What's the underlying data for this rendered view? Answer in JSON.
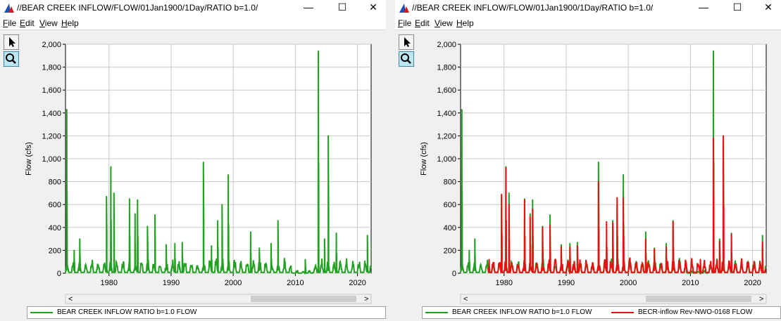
{
  "windows": [
    {
      "title": "//BEAR CREEK INFLOW/FLOW/01Jan1900/1Day/RATIO b=1.0/",
      "menu": [
        {
          "ul": "F",
          "rest": "ile"
        },
        {
          "ul": "E",
          "rest": "dit"
        },
        {
          "ul": "V",
          "rest": "iew"
        },
        {
          "ul": "H",
          "rest": "elp"
        }
      ],
      "legend": [
        {
          "label": "BEAR CREEK INFLOW RATIO b=1.0 FLOW",
          "color": "#22a022"
        }
      ]
    },
    {
      "title": "//BEAR CREEK INFLOW/FLOW/01Jan1900/1Day/RATIO b=1.0/",
      "menu": [
        {
          "ul": "F",
          "rest": "ile"
        },
        {
          "ul": "E",
          "rest": "dit"
        },
        {
          "ul": "V",
          "rest": "iew"
        },
        {
          "ul": "H",
          "rest": "elp"
        }
      ],
      "legend": [
        {
          "label": "BEAR CREEK INFLOW RATIO b=1.0 FLOW",
          "color": "#22a022"
        },
        {
          "label": "BECR-inflow Rev-NWO-0168 FLOW",
          "color": "#e81010"
        }
      ]
    }
  ],
  "window_controls": {
    "minimize": "—",
    "maximize": "☐",
    "close": "✕"
  },
  "icons": {
    "pointer": "pointer-arrow-icon",
    "zoom": "zoom-magnifier-icon",
    "app": "hec-dssvue-icon"
  },
  "chart_data": [
    {
      "type": "line",
      "ylabel": "Flow (cfs)",
      "xlabel": "",
      "title": "",
      "xlim": [
        1973.0,
        2022.2
      ],
      "ylim": [
        0,
        2000
      ],
      "yticks": [
        0,
        200,
        400,
        600,
        800,
        1000,
        1200,
        1400,
        1600,
        1800,
        2000
      ],
      "ytick_labels": [
        "0",
        "200",
        "400",
        "600",
        "800",
        "1,000",
        "1,200",
        "1,400",
        "1,600",
        "1,800",
        "2,000"
      ],
      "xticks": [
        1980,
        1990,
        2000,
        2010,
        2020
      ],
      "grid": true,
      "series": [
        {
          "name": "BEAR CREEK INFLOW RATIO b=1.0 FLOW",
          "color": "#22a022",
          "x": [
            1973.2,
            1974.4,
            1975.3,
            1979.6,
            1980.3,
            1980.8,
            1983.3,
            1984.2,
            1984.6,
            1986.2,
            1987.4,
            1989.2,
            1990.6,
            1991.8,
            1995.2,
            1996.5,
            1997.5,
            1998.2,
            1999.2,
            2002.8,
            2004.2,
            2006.1,
            2007.2,
            2011.6,
            2013.7,
            2014.7,
            2015.3,
            2016.6,
            2021.6
          ],
          "peaks": [
            1430,
            200,
            300,
            670,
            930,
            700,
            650,
            520,
            640,
            410,
            510,
            250,
            260,
            270,
            970,
            240,
            460,
            600,
            860,
            360,
            220,
            260,
            460,
            120,
            1940,
            300,
            1200,
            350,
            330
          ]
        }
      ]
    },
    {
      "type": "line",
      "ylabel": "Flow (cfs)",
      "xlabel": "",
      "title": "",
      "xlim": [
        1973.0,
        2022.2
      ],
      "ylim": [
        0,
        2000
      ],
      "yticks": [
        0,
        200,
        400,
        600,
        800,
        1000,
        1200,
        1400,
        1600,
        1800,
        2000
      ],
      "ytick_labels": [
        "0",
        "200",
        "400",
        "600",
        "800",
        "1,000",
        "1,200",
        "1,400",
        "1,600",
        "1,800",
        "2,000"
      ],
      "xticks": [
        1980,
        1990,
        2000,
        2010,
        2020
      ],
      "grid": true,
      "series": [
        {
          "name": "BEAR CREEK INFLOW RATIO b=1.0 FLOW",
          "color": "#22a022",
          "x": [
            1973.2,
            1974.4,
            1975.3,
            1979.6,
            1980.3,
            1980.8,
            1983.3,
            1984.2,
            1984.6,
            1986.2,
            1987.4,
            1989.2,
            1990.6,
            1991.8,
            1995.2,
            1996.5,
            1997.5,
            1998.2,
            1999.2,
            2002.8,
            2004.2,
            2006.1,
            2007.2,
            2011.6,
            2013.7,
            2014.7,
            2015.3,
            2016.6,
            2021.6
          ],
          "peaks": [
            1430,
            200,
            300,
            670,
            930,
            700,
            650,
            520,
            640,
            410,
            510,
            250,
            260,
            270,
            970,
            240,
            460,
            600,
            860,
            360,
            220,
            260,
            460,
            120,
            1940,
            300,
            1200,
            350,
            330
          ]
        },
        {
          "name": "BECR-inflow Rev-NWO-0168 FLOW",
          "color": "#e81010",
          "x": [
            1977.6,
            1979.6,
            1980.3,
            1980.8,
            1983.3,
            1984.2,
            1984.6,
            1986.2,
            1987.4,
            1989.2,
            1990.6,
            1991.8,
            1995.2,
            1996.5,
            1997.5,
            1998.2,
            1999.2,
            2002.8,
            2004.2,
            2006.1,
            2007.2,
            2011.6,
            2013.7,
            2014.7,
            2015.3,
            2016.6,
            2021.6
          ],
          "peaks": [
            120,
            690,
            920,
            600,
            640,
            490,
            560,
            400,
            420,
            230,
            230,
            240,
            800,
            450,
            440,
            660,
            660,
            300,
            210,
            230,
            450,
            120,
            1180,
            280,
            1200,
            340,
            270
          ]
        }
      ]
    }
  ]
}
